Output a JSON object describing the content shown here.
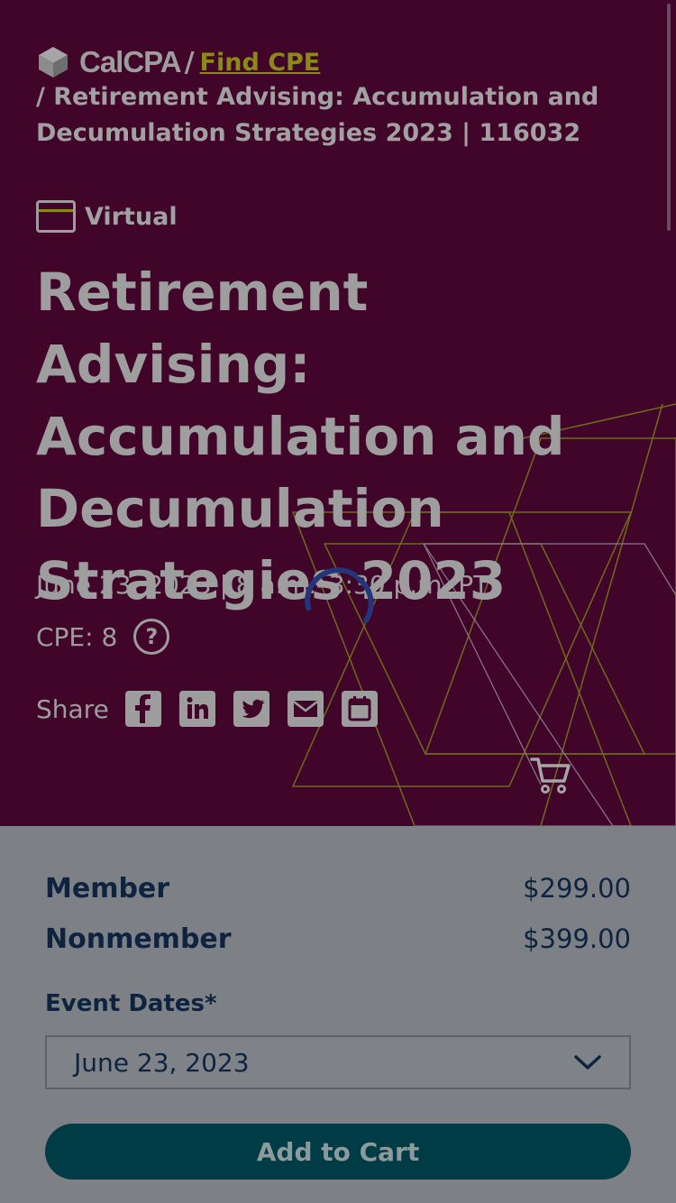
{
  "breadcrumb": {
    "logo_text": "CalCPA",
    "separator": "/",
    "find_link": "Find CPE",
    "rest": "/ Retirement Advising: Accumulation and Decumulation Strategies 2023 | 116032"
  },
  "event": {
    "format_label": "Virtual",
    "title": "Retirement Advising: Accumulation and Decumulation Strategies 2023",
    "date_time": "June 23, 2023 | 8 a.m.–3:30 p.m. PT",
    "cpe": "CPE: 8",
    "help_glyph": "?",
    "share_label": "Share"
  },
  "share_icons": [
    "facebook-icon",
    "linkedin-icon",
    "twitter-icon",
    "email-icon",
    "calendar-icon"
  ],
  "pricing": {
    "member_label": "Member",
    "member_price": "$299.00",
    "nonmember_label": "Nonmember",
    "nonmember_price": "$399.00"
  },
  "registration": {
    "dates_label": "Event Dates*",
    "selected_date": "June 23, 2023",
    "add_to_cart": "Add to Cart"
  },
  "colors": {
    "hero_bg": "#41052a",
    "panel_bg": "#7d8186",
    "accent_link": "#8a8a14",
    "button_bg": "#003c46",
    "text_dark": "#0d2340"
  }
}
